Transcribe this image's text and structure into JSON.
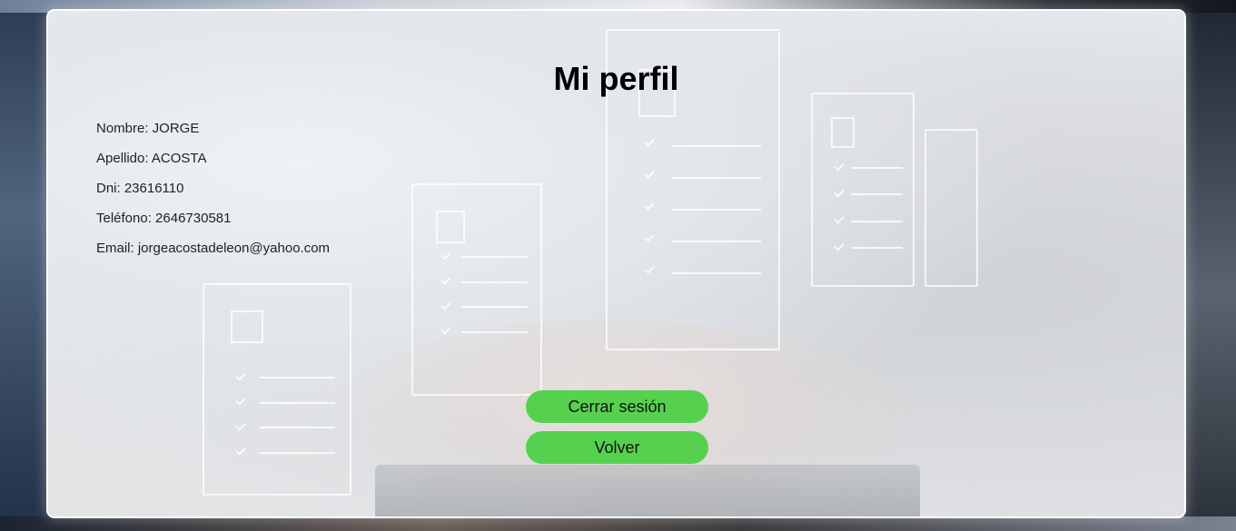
{
  "profile": {
    "title": "Mi perfil",
    "fields": {
      "nombre": "Nombre: JORGE",
      "apellido": "Apellido: ACOSTA",
      "dni": "Dni: 23616110",
      "telefono": "Teléfono: 2646730581",
      "email": "Email: jorgeacostadeleon@yahoo.com"
    }
  },
  "actions": {
    "logout_label": "Cerrar sesión",
    "back_label": "Volver"
  },
  "colors": {
    "button_bg": "#56d14f",
    "card_border": "#ffffff",
    "title_text": "#000000"
  }
}
